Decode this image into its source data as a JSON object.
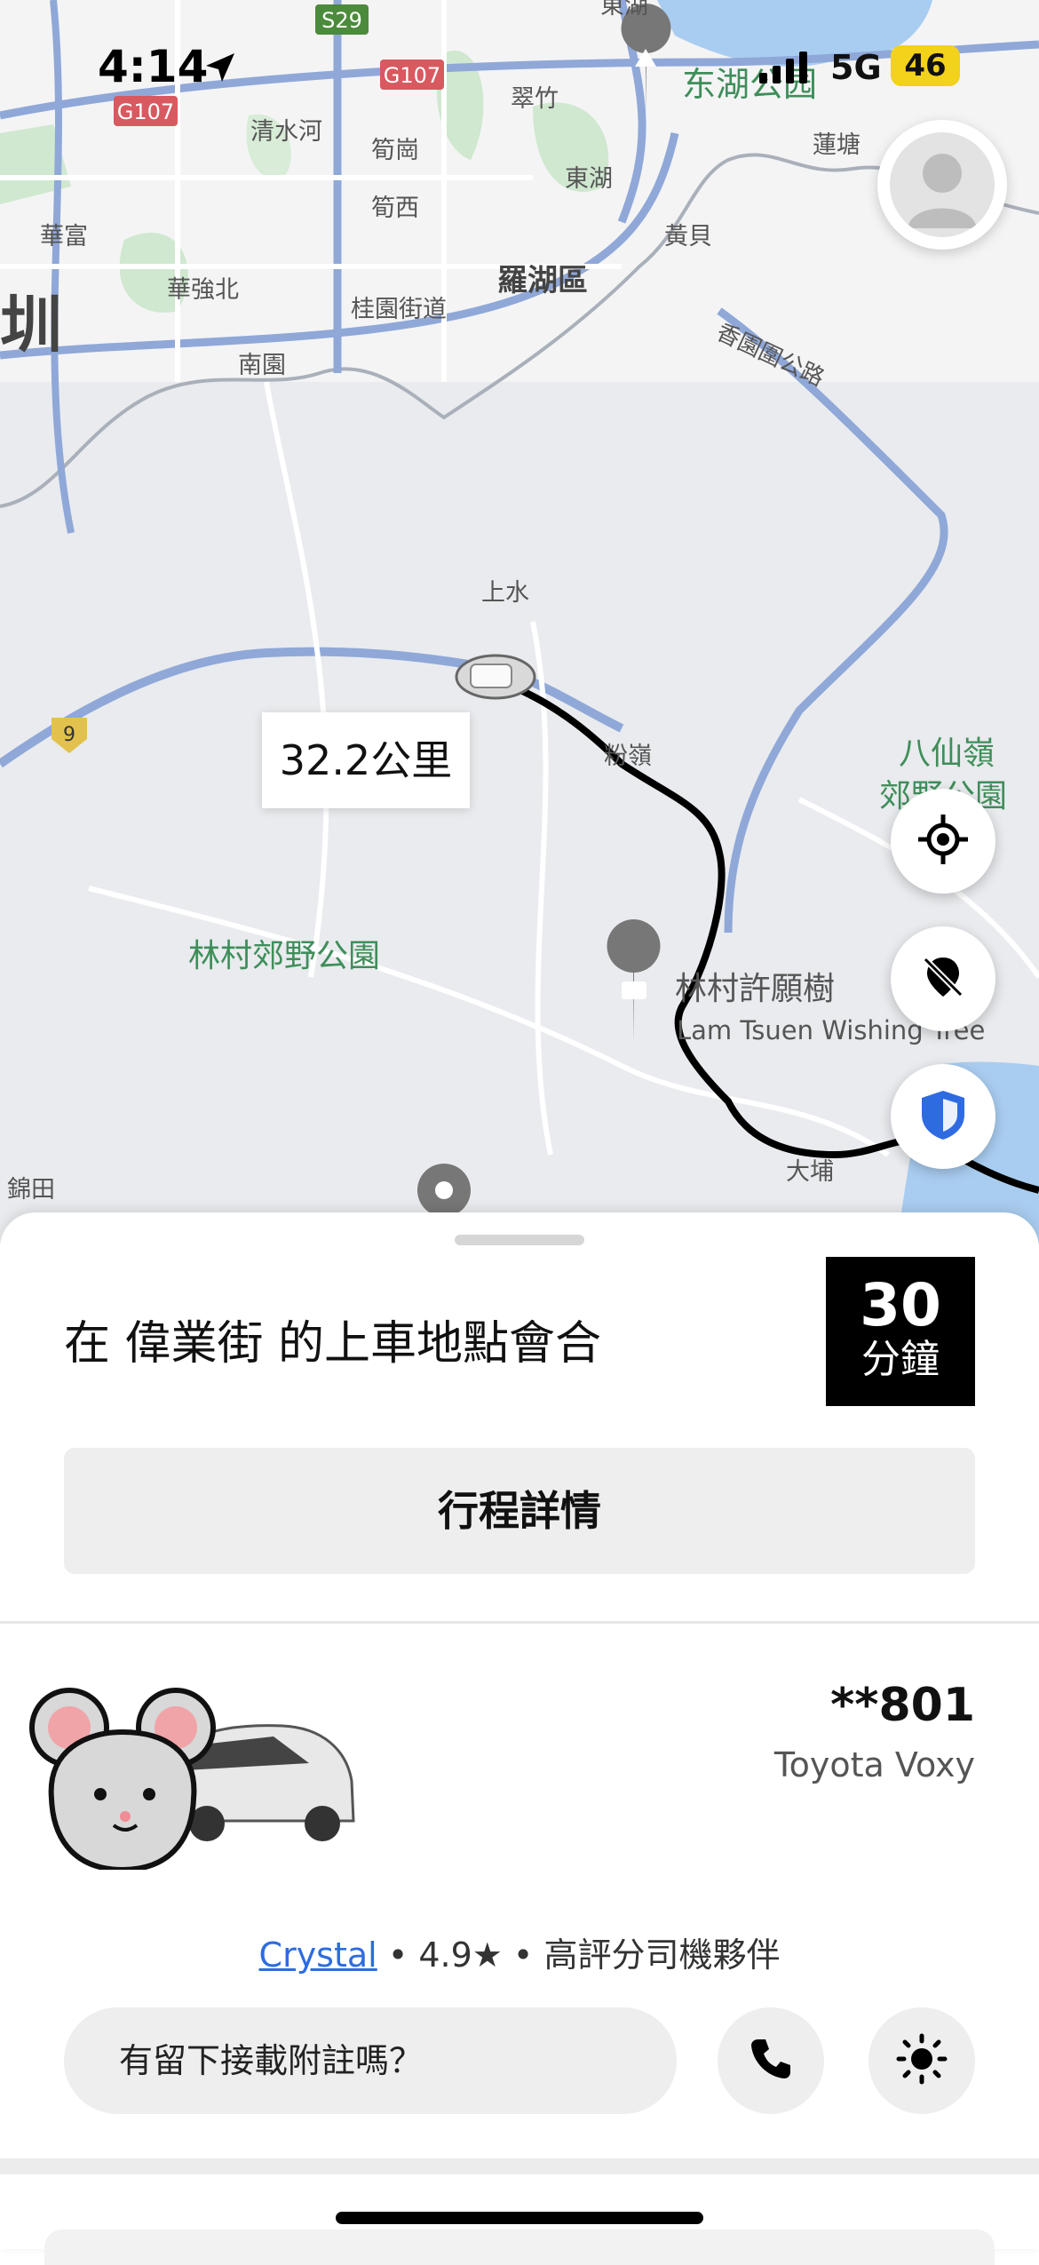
{
  "status_bar": {
    "time": "4:14",
    "network": "5G",
    "battery": "46"
  },
  "map": {
    "distance_label": "32.2公里",
    "labels": {
      "shenzhen_partial": "圳",
      "huafu": "華富",
      "huaqiang_north": "華強北",
      "nanyuan": "南園",
      "qingshuihe": "清水河",
      "sungang": "筍崗",
      "sunxi": "筍西",
      "guiyuan_street": "桂園街道",
      "cuizhu": "翠竹",
      "dongHu": "東湖",
      "luohu_district": "羅湖區",
      "huangbei": "黃貝",
      "donghu_park": "东湖公园",
      "liantang": "蓮塘",
      "xiangyuan_road": "香園圍公路",
      "dongHu_top": "東湖",
      "sheung_shui": "上水",
      "fanling": "粉嶺",
      "pat_sin_leng_1": "八仙嶺",
      "pat_sin_leng_2": "郊野公園",
      "lam_tsuen_park": "林村郊野公園",
      "wishing_tree": "林村許願樹",
      "wishing_tree_en": "Lam Tsuen Wishing Tree",
      "tai_po": "大埔",
      "kam_tin": "錦田",
      "road_g107_a": "G107",
      "road_g107_b": "G107",
      "road_s29": "S29",
      "route_9": "9"
    },
    "colors": {
      "land": "#e9ebee",
      "urban": "#f3f3f4",
      "park": "#c8e6c9",
      "water": "#a9cdf0",
      "highway": "#8fa8d8",
      "route": "#000000"
    }
  },
  "controls": {
    "profile_icon": "person-icon",
    "locate_icon": "crosshair-icon",
    "safety_icon": "shield-icon",
    "hide_icon": "location-off-icon"
  },
  "sheet": {
    "pickup_message": "在 偉業街 的上車地點會合",
    "eta_value": "30",
    "eta_unit": "分鐘",
    "trip_details_label": "行程詳情",
    "plate": "**801",
    "car_model": "Toyota Voxy",
    "driver_name": "Crystal",
    "separator": "•",
    "rating": "4.9★",
    "badge": "高評分司機夥伴",
    "note_prompt": "有留下接載附註嗎？",
    "call_icon": "phone-icon",
    "extra_icon": "sun-icon"
  }
}
